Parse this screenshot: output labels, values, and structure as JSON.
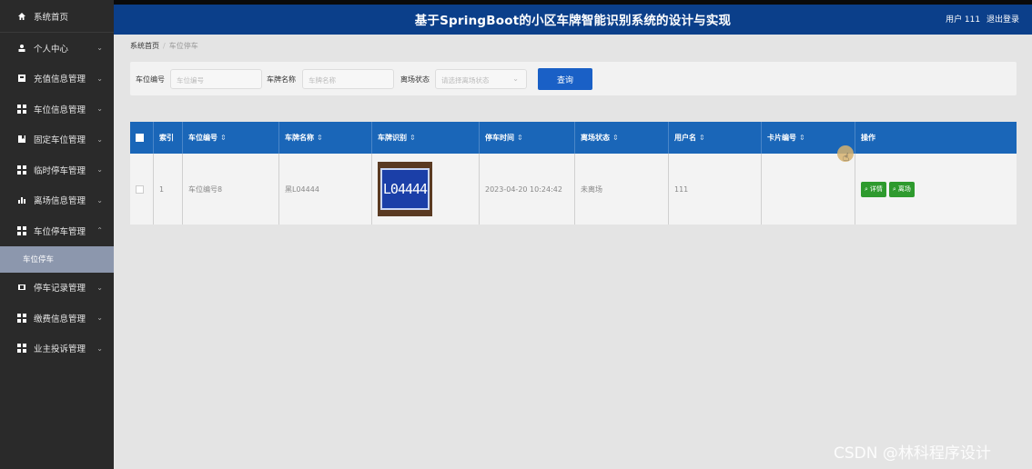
{
  "sidebar": {
    "home": {
      "label": "系统首页",
      "icon": "home-icon"
    },
    "items": [
      {
        "label": "个人中心",
        "icon": "person-icon",
        "chevron": "⌄"
      },
      {
        "label": "充值信息管理",
        "icon": "card-icon",
        "chevron": "⌄"
      },
      {
        "label": "车位信息管理",
        "icon": "grid-icon",
        "chevron": "⌄"
      },
      {
        "label": "固定车位管理",
        "icon": "bookmark-icon",
        "chevron": "⌄"
      },
      {
        "label": "临时停车管理",
        "icon": "grid-icon",
        "chevron": "⌄"
      },
      {
        "label": "离场信息管理",
        "icon": "bar-chart-icon",
        "chevron": "⌄"
      },
      {
        "label": "车位停车管理",
        "icon": "grid-icon",
        "chevron": "⌃"
      }
    ],
    "active_sub": "车位停车",
    "items_after": [
      {
        "label": "停车记录管理",
        "icon": "film-icon",
        "chevron": "⌄"
      },
      {
        "label": "缴费信息管理",
        "icon": "grid-icon",
        "chevron": "⌄"
      },
      {
        "label": "业主投诉管理",
        "icon": "grid-icon",
        "chevron": "⌄"
      }
    ]
  },
  "header": {
    "title": "基于SpringBoot的小区车牌智能识别系统的设计与实现",
    "user": "用户 111",
    "logout": "退出登录"
  },
  "breadcrumb": {
    "home": "系统首页",
    "current": "车位停车"
  },
  "search": {
    "field1": {
      "label": "车位编号",
      "placeholder": "车位编号"
    },
    "field2": {
      "label": "车牌名称",
      "placeholder": "车牌名称"
    },
    "field3": {
      "label": "离场状态",
      "placeholder": "请选择离场状态"
    },
    "query_button": "查询"
  },
  "table": {
    "headers": [
      "索引",
      "车位编号",
      "车牌名称",
      "车牌识别",
      "停车时间",
      "离场状态",
      "用户名",
      "卡片编号",
      "操作"
    ],
    "rows": [
      {
        "index": "1",
        "space_no": "车位编号8",
        "plate_name": "黑L04444",
        "plate_image_text": "L04444",
        "park_time": "2023-04-20 10:24:42",
        "status": "未离场",
        "username": "111",
        "card_no": "",
        "btn_detail": "详情",
        "btn_leave": "离场"
      }
    ]
  },
  "watermark": "CSDN @林科程序设计"
}
